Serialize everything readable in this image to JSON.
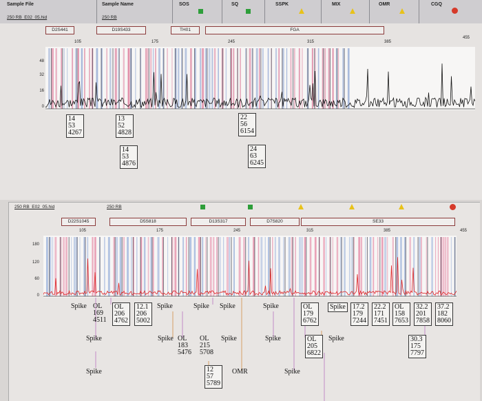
{
  "header": {
    "columns": [
      "Sample File",
      "Sample Name",
      "SOS",
      "SQ",
      "SSPK",
      "MIX",
      "OMR",
      "CGQ"
    ],
    "file_name": "250 RB_E02_05.hid",
    "sample_name": "250 RB"
  },
  "panel1": {
    "loci": [
      "D2S441",
      "D19S433",
      "TH01",
      "FGA"
    ],
    "scale": [
      "105",
      "175",
      "245",
      "315",
      "385",
      "455"
    ],
    "yticks": [
      "48",
      "32",
      "16",
      "0"
    ],
    "labels": [
      {
        "text": "14\n53\n4267"
      },
      {
        "text": "13\n52\n4828"
      },
      {
        "text": "14\n53\n4876"
      },
      {
        "text": "22\n56\n6154"
      },
      {
        "text": "24\n63\n6245"
      }
    ]
  },
  "panel2": {
    "file_name": "250 RB_E02_05.hid",
    "sample_name": "250 RB",
    "loci": [
      "D22S1045",
      "D5S818",
      "D13S317",
      "D7S820",
      "SE33"
    ],
    "scale": [
      "105",
      "175",
      "245",
      "315",
      "385",
      "455"
    ],
    "yticks": [
      "180",
      "120",
      "60",
      "0"
    ],
    "labels": [
      {
        "text": "Spike"
      },
      {
        "text": "OL\n169\n4511"
      },
      {
        "text": "OL\n206\n4762"
      },
      {
        "text": "12.1\n206\n5002"
      },
      {
        "text": "Spike"
      },
      {
        "text": "Spike"
      },
      {
        "text": "Spike"
      },
      {
        "text": "Spike"
      },
      {
        "text": "OL\n179\n6762"
      },
      {
        "text": "Spike"
      },
      {
        "text": "17.2\n179\n7244"
      },
      {
        "text": "22.2\n171\n7451"
      },
      {
        "text": "OL\n158\n7653"
      },
      {
        "text": "32.2\n201\n7858"
      },
      {
        "text": "37.2\n182\n8060"
      },
      {
        "text": "Spike"
      },
      {
        "text": "Spike"
      },
      {
        "text": "OL\n183\n5476"
      },
      {
        "text": "OL\n215\n5708"
      },
      {
        "text": "Spike"
      },
      {
        "text": "Spike"
      },
      {
        "text": "OL\n205\n6822"
      },
      {
        "text": "Spike"
      },
      {
        "text": "30.3\n175\n7797"
      },
      {
        "text": "Spike"
      },
      {
        "text": "12\n57\n5789"
      },
      {
        "text": "OMR"
      },
      {
        "text": "Spike"
      }
    ]
  }
}
